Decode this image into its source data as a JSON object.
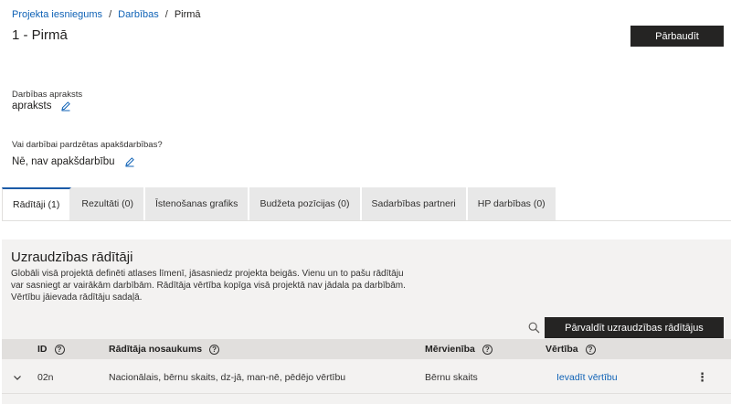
{
  "breadcrumb": {
    "items": [
      "Projekta iesniegums",
      "Darbības"
    ],
    "current": "Pirmā",
    "separator": "/"
  },
  "page": {
    "title": "1 - Pirmā"
  },
  "header": {
    "check_button": "Pārbaudīt"
  },
  "description_field": {
    "label": "Darbības apraksts",
    "value": "apraksts"
  },
  "subactivities_field": {
    "label": "Vai darbībai pardzētas apakšdarbības?",
    "value": "Nē, nav apakšdarbību"
  },
  "tabs": [
    {
      "label": "Rādītāji (1)",
      "active": true
    },
    {
      "label": "Rezultāti (0)",
      "active": false
    },
    {
      "label": "Īstenošanas grafiks",
      "active": false
    },
    {
      "label": "Budžeta pozīcijas (0)",
      "active": false
    },
    {
      "label": "Sadarbības partneri",
      "active": false
    },
    {
      "label": "HP darbības (0)",
      "active": false
    }
  ],
  "indicators": {
    "title": "Uzraudzības rādītāji",
    "description": "Globāli visā projektā definēti atlases līmenī, jāsasniedz projekta beigās. Vienu un to pašu rādītāju var sasniegt ar vairākām darbībām. Rādītāja vērtība kopīga visā projektā nav jādala pa darbībām. Vērtību jāievada rādītāju sadaļā.",
    "manage_button": "Pārvaldīt uzraudzības rādītājus",
    "columns": {
      "id": "ID",
      "name": "Rādītāja nosaukums",
      "unit": "Mērvienība",
      "value": "Vērtība"
    },
    "rows": [
      {
        "id": "02n",
        "name": "Nacionālais, bērnu skaits, dz-jā, man-nē, pēdējo vērtību",
        "unit": "Bērnu skaits",
        "value_link": "Ievadīt vērtību"
      }
    ]
  },
  "colors": {
    "accent": "#0f62b6",
    "dark_button": "#252423",
    "panel_bg": "#f3f2f1",
    "header_bg": "#e1dfdd",
    "tab_bg": "#e8e8e8",
    "active_tab_border": "#1b5ba8"
  },
  "icons": {
    "edit": "pencil-icon",
    "search": "search-icon",
    "help": "question-circle-icon",
    "expand": "chevron-down-icon",
    "more": "more-vertical-icon"
  }
}
